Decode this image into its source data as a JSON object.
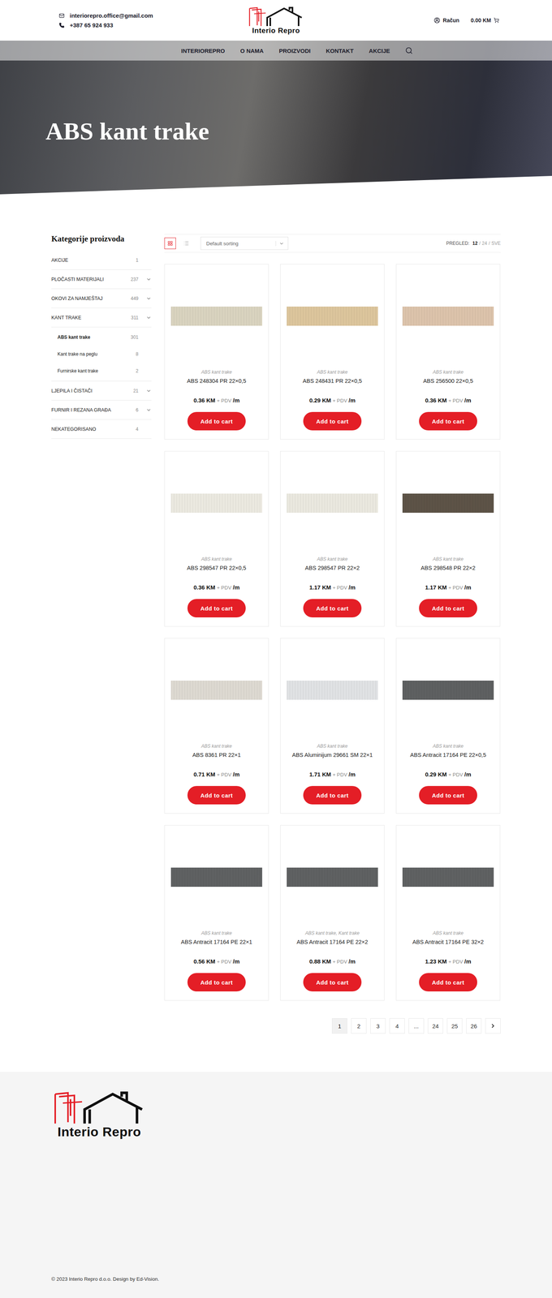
{
  "header": {
    "email": "interiorepro.office@gmail.com",
    "phone": "+387 65 924 933",
    "account": "Račun",
    "cart_total": "0.00 KM"
  },
  "logo": {
    "text": "Interio Repro"
  },
  "nav": [
    {
      "label": "INTERIOREPRO"
    },
    {
      "label": "O NAMA"
    },
    {
      "label": "PROIZVODI"
    },
    {
      "label": "KONTAKT"
    },
    {
      "label": "AKCIJE"
    }
  ],
  "hero": {
    "title": "ABS kant trake"
  },
  "sidebar": {
    "title": "Kategorije proizvoda",
    "categories": [
      {
        "label": "AKCIJE",
        "count": "1",
        "expandable": false,
        "expanded": false,
        "children": []
      },
      {
        "label": "PLOČASTI MATERIJALI",
        "count": "237",
        "expandable": true,
        "expanded": false,
        "children": []
      },
      {
        "label": "OKOVI ZA NAMJEŠTAJ",
        "count": "449",
        "expandable": true,
        "expanded": false,
        "children": []
      },
      {
        "label": "KANT TRAKE",
        "count": "311",
        "expandable": true,
        "expanded": true,
        "children": [
          {
            "label": "ABS kant trake",
            "count": "301",
            "selected": true
          },
          {
            "label": "Kant trake na peglu",
            "count": "8",
            "selected": false
          },
          {
            "label": "Furnirske kant trake",
            "count": "2",
            "selected": false
          }
        ]
      },
      {
        "label": "LJEPILA I ČISTAČI",
        "count": "21",
        "expandable": true,
        "expanded": false,
        "children": []
      },
      {
        "label": "FURNIR I REZANA GRAĐA",
        "count": "6",
        "expandable": true,
        "expanded": false,
        "children": []
      },
      {
        "label": "NEKATEGORISANO",
        "count": "4",
        "expandable": false,
        "expanded": false,
        "children": []
      }
    ]
  },
  "toolbar": {
    "views": [
      {
        "kind": "grid",
        "selected": true
      },
      {
        "kind": "list",
        "selected": false
      }
    ],
    "sort": "Default sorting",
    "per_page_label": "PREGLED:",
    "separator": "/",
    "per_page": [
      {
        "label": "12",
        "selected": true
      },
      {
        "label": "24",
        "selected": false
      },
      {
        "label": "SVE",
        "selected": false
      }
    ]
  },
  "products": [
    {
      "category": "ABS kant trake",
      "name": "ABS 248304 PR 22×0,5",
      "price": "0.36 KM",
      "tax": "+ PDV",
      "unit": "/m",
      "color": "#d9d3bf",
      "button": "Add to cart"
    },
    {
      "category": "ABS kant trake",
      "name": "ABS 248431 PR 22×0,5",
      "price": "0.29 KM",
      "tax": "+ PDV",
      "unit": "/m",
      "color": "#dcc59c",
      "button": "Add to cart"
    },
    {
      "category": "ABS kant trake",
      "name": "ABS 256500 22×0,5",
      "price": "0.36 KM",
      "tax": "+ PDV",
      "unit": "/m",
      "color": "#dcc3ab",
      "button": "Add to cart"
    },
    {
      "category": "ABS kant trake",
      "name": "ABS 298547 PR 22×0,5",
      "price": "0.36 KM",
      "tax": "+ PDV",
      "unit": "/m",
      "color": "#ebe9e0",
      "button": "Add to cart"
    },
    {
      "category": "ABS kant trake",
      "name": "ABS 298547 PR 22×2",
      "price": "1.17 KM",
      "tax": "+ PDV",
      "unit": "/m",
      "color": "#eae8df",
      "button": "Add to cart"
    },
    {
      "category": "ABS kant trake",
      "name": "ABS 298548 PR 22×2",
      "price": "1.17 KM",
      "tax": "+ PDV",
      "unit": "/m",
      "color": "#5d5347",
      "button": "Add to cart"
    },
    {
      "category": "ABS kant trake",
      "name": "ABS 8361 PR 22×1",
      "price": "0.71 KM",
      "tax": "+ PDV",
      "unit": "/m",
      "color": "#ddd9d1",
      "button": "Add to cart"
    },
    {
      "category": "ABS kant trake",
      "name": "ABS Aluminijum 29661 SM 22×1",
      "price": "1.71 KM",
      "tax": "+ PDV",
      "unit": "/m",
      "color": "#e0e2e4",
      "button": "Add to cart"
    },
    {
      "category": "ABS kant trake",
      "name": "ABS Antracit 17164 PE 22×0,5",
      "price": "0.29 KM",
      "tax": "+ PDV",
      "unit": "/m",
      "color": "#5e6061",
      "button": "Add to cart"
    },
    {
      "category": "ABS kant trake",
      "name": "ABS Antracit 17164 PE 22×1",
      "price": "0.56 KM",
      "tax": "+ PDV",
      "unit": "/m",
      "color": "#5f6162",
      "button": "Add to cart"
    },
    {
      "category": "ABS kant trake, Kant trake",
      "name": "ABS Antracit 17164 PE 22×2",
      "price": "0.88 KM",
      "tax": "+ PDV",
      "unit": "/m",
      "color": "#5f6162",
      "button": "Add to cart"
    },
    {
      "category": "ABS kant trake",
      "name": "ABS Antracit 17164 PE 32×2",
      "price": "1.23 KM",
      "tax": "+ PDV",
      "unit": "/m",
      "color": "#5f6162",
      "button": "Add to cart"
    }
  ],
  "pagination": {
    "pages": [
      {
        "label": "1",
        "selected": true
      },
      {
        "label": "2",
        "selected": false
      },
      {
        "label": "3",
        "selected": false
      },
      {
        "label": "4",
        "selected": false
      },
      {
        "label": "...",
        "selected": false
      },
      {
        "label": "24",
        "selected": false
      },
      {
        "label": "25",
        "selected": false
      },
      {
        "label": "26",
        "selected": false
      }
    ]
  },
  "footer": {
    "copyright": "© 2023 Interio Repro d.o.o. Design by Ed-Vision."
  }
}
